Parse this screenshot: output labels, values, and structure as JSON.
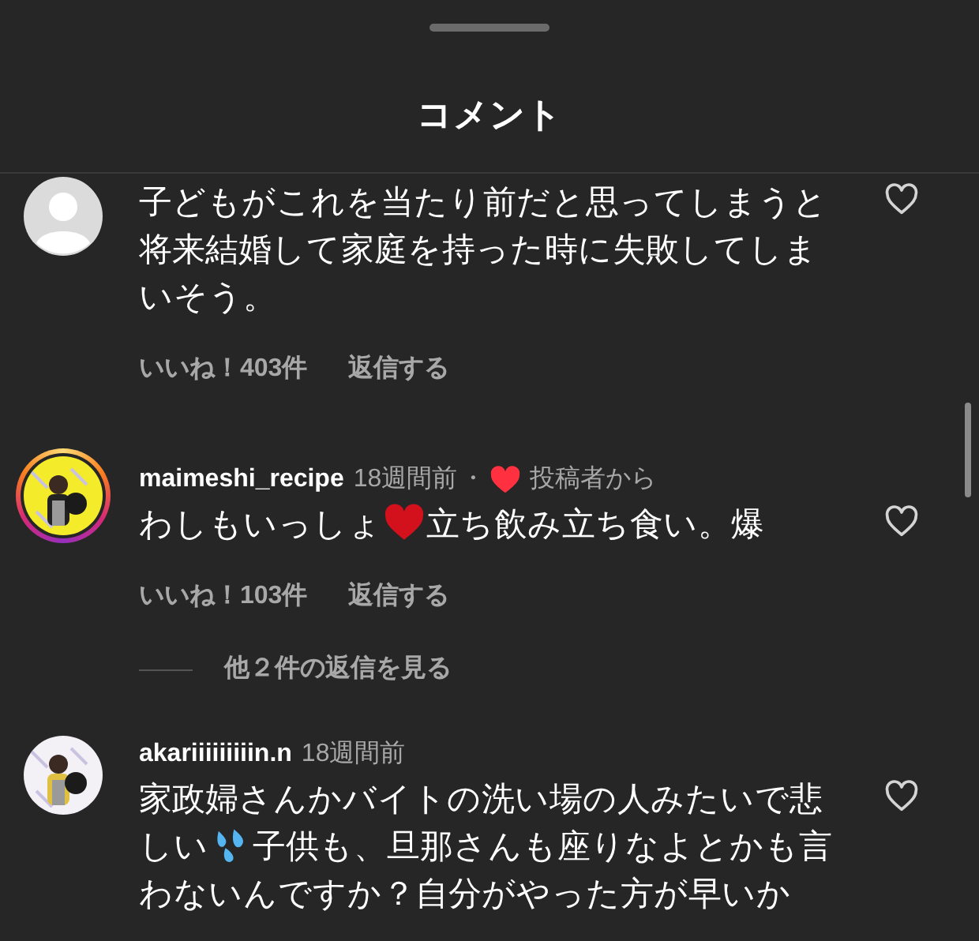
{
  "header": {
    "title": "コメント"
  },
  "comments": [
    {
      "avatar": {
        "kind": "default"
      },
      "story_ring": false,
      "liked": false,
      "parts": [
        {
          "kind": "text",
          "text": "子どもがこれを当たり前だと思ってしまうと将来結婚して家庭を持った時に失敗してしまいそう。"
        }
      ],
      "likes": "いいね！403件",
      "reply": "返信する"
    },
    {
      "story_ring": true,
      "user": "maimeshi_recipe",
      "time": "18週間前",
      "separator": "・",
      "author_liked": true,
      "author_label": "投稿者から",
      "liked": false,
      "parts": [
        {
          "kind": "text",
          "text": "わしもいっしょ"
        },
        {
          "kind": "heart"
        },
        {
          "kind": "text",
          "text": "立ち飲み立ち食い。爆"
        }
      ],
      "likes": "いいね！103件",
      "reply": "返信する",
      "more_replies": "他２件の返信を見る"
    },
    {
      "story_ring": false,
      "user": "akariiiiiiiiin.n",
      "time": "18週間前",
      "liked": false,
      "parts": [
        {
          "kind": "text",
          "text": "家政婦さんかバイトの洗い場の人みたいで悲しい"
        },
        {
          "kind": "droplets"
        },
        {
          "kind": "text",
          "text": "子供も、旦那さんも座りなよとかも言わないんですか？自分がやった方が早いか"
        }
      ]
    }
  ]
}
